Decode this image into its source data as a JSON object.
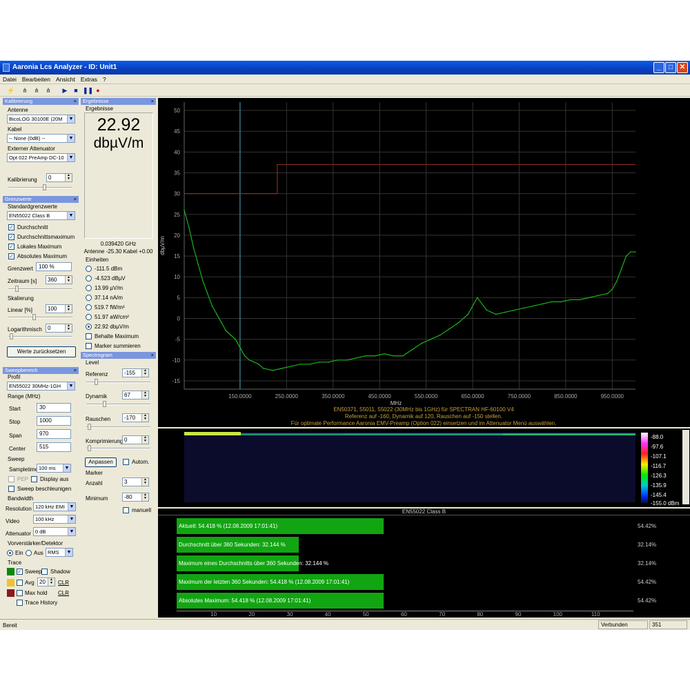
{
  "window": {
    "title": "Aaronia Lcs Analyzer - ID: Unit1"
  },
  "menu": [
    "Datei",
    "Bearbeiten",
    "Ansicht",
    "Extras",
    "?"
  ],
  "toolbar_icons": [
    "wand-icon",
    "antenna-icon",
    "antenna2-icon",
    "antenna3-icon",
    "play-icon",
    "stop-icon",
    "pause-icon",
    "record-icon"
  ],
  "kalibrierung": {
    "header": "Kalibrierung",
    "antenne_label": "Antenne",
    "antenne_value": "BicoLOG 30100E (20M",
    "kabel_label": "Kabel",
    "kabel_value": "-- None (0dB) --",
    "att_label": "Externer Attenuator",
    "att_value": "Opt 022 PreAmp DC-10",
    "kal_label": "Kalibrierung",
    "kal_value": "0"
  },
  "grenzwerte": {
    "header": "Grenzwerte",
    "std_label": "Standardgrenzwerte",
    "std_value": "EN55022 Class B",
    "checks": [
      "Durchschnitt",
      "Durchschnittsmaximum",
      "Lokales Maximum",
      "Absolutes Maximum"
    ],
    "grenzwert_label": "Grenzwert",
    "grenzwert_value": "100 %",
    "zeitraum_label": "Zeitraum [s]",
    "zeitraum_value": "360",
    "skal_label": "Skalierung",
    "linear_label": "Linear [%]",
    "linear_value": "100",
    "log_label": "Logarithmisch",
    "log_value": "0",
    "reset_button": "Werte zurücksetzen"
  },
  "sweep": {
    "header": "Sweepbereich",
    "profil_label": "Profil",
    "profil_value": "EN55022 30MHz-1GH",
    "range_label": "Range (MHz)",
    "start_label": "Start",
    "start_value": "30",
    "stop_label": "Stop",
    "stop_value": "1000",
    "span_label": "Span",
    "span_value": "970",
    "center_label": "Center",
    "center_value": "515",
    "sweep_label": "Sweep",
    "sampletime_label": "Sampletime",
    "sampletime_value": "100 ms",
    "pep_label": "PEP",
    "display_label": "Display aus",
    "beschl_label": "Sweep beschleunigen",
    "bandwidth_label": "Bandwidth",
    "resolution_label": "Resolution",
    "resolution_value": "120 kHz EMI",
    "video_label": "Video",
    "video_value": "100 kHz",
    "atten_label": "Attenuator",
    "atten_value": "0 dB",
    "vorv_label": "Vorverstärker/Detektor",
    "ein_label": "Ein",
    "aus_label": "Aus",
    "det_value": "RMS",
    "trace_label": "Trace",
    "sweep_cb": "Sweep",
    "shadow_cb": "Shadow",
    "avg_cb": "Avg",
    "avg_value": "20",
    "clr": "CLR",
    "maxhold_cb": "Max hold",
    "history_cb": "Trace History",
    "colors": [
      "#0a8a0a",
      "#f2c12e",
      "#8b1a1a"
    ]
  },
  "ergebnisse": {
    "header": "Ergebnisse",
    "group": "Ergebnisse",
    "value": "22.92",
    "unit": "dbµV/m",
    "freq": "0.039420 GHz",
    "antenne": "Antenne -25.30 Kabel +0.00",
    "einheiten_label": "Einheiten",
    "units": [
      "-111.5 dBm",
      "-4.523 dBµV",
      "13.99 µV/m",
      "37.14 nA/m",
      "519.7 fW/m²",
      "51.97 aW/cm²",
      "22.92 dbµV/m"
    ],
    "selected_unit_index": 6,
    "behalte": "Behalte Maximum",
    "summieren": "Marker summieren"
  },
  "spectrogram": {
    "header": "Spectrogram",
    "level_label": "Level",
    "referenz_label": "Referenz",
    "referenz_value": "-155",
    "dynamik_label": "Dynamik",
    "dynamik_value": "67",
    "rauschen_label": "Rauschen",
    "rauschen_value": "-170",
    "kompr_label": "Komprimierung",
    "kompr_value": "0",
    "anpassen_button": "Anpassen",
    "autom_label": "Autom.",
    "marker_label": "Marker",
    "anzahl_label": "Anzahl",
    "anzahl_value": "3",
    "minimum_label": "Minimum",
    "minimum_value": "-80",
    "manuell_label": "manuell",
    "scale": [
      "-88.0",
      "-97.6",
      "-107.1",
      "-116.7",
      "-126.3",
      "-135.9",
      "-145.4",
      "-155.0 dBm"
    ]
  },
  "chart_data": {
    "type": "line",
    "ylabel": "dbµV/m",
    "xlabel": "MHz",
    "xlim": [
      30,
      1000
    ],
    "ylim": [
      -17,
      52
    ],
    "y_ticks": [
      50,
      45,
      40,
      35,
      30,
      25,
      20,
      15,
      10,
      5,
      0,
      -5,
      -10,
      -15
    ],
    "x_ticks": [
      "150.0000",
      "250.0000",
      "350.0000",
      "450.0000",
      "550.0000",
      "650.0000",
      "750.0000",
      "850.0000",
      "950.0000"
    ],
    "limit_line": {
      "x": [
        30,
        230,
        230,
        1000
      ],
      "y": [
        30,
        30,
        37,
        37
      ],
      "color": "#8b2a1a"
    },
    "marker_x": 150,
    "series": [
      {
        "color": "#19b419",
        "x": [
          30,
          40,
          50,
          60,
          70,
          80,
          90,
          100,
          110,
          120,
          130,
          140,
          150,
          160,
          170,
          180,
          190,
          200,
          220,
          240,
          260,
          280,
          300,
          320,
          340,
          360,
          380,
          400,
          420,
          440,
          460,
          480,
          500,
          520,
          540,
          560,
          580,
          600,
          620,
          640,
          660,
          680,
          700,
          720,
          740,
          760,
          780,
          800,
          820,
          840,
          860,
          880,
          900,
          920,
          940,
          950,
          960,
          970,
          980,
          990,
          1000
        ],
        "y": [
          26,
          22,
          17,
          13,
          9,
          6,
          3,
          1,
          -1,
          -3,
          -4,
          -5,
          -7,
          -9,
          -10,
          -10.5,
          -11,
          -12,
          -12.5,
          -12,
          -11.5,
          -11,
          -11,
          -10.5,
          -10.5,
          -10,
          -10,
          -9.5,
          -9,
          -9,
          -8.5,
          -9,
          -9,
          -7.5,
          -6,
          -5,
          -4,
          -2.5,
          -1,
          1,
          5,
          2,
          1,
          1.5,
          2,
          2.5,
          3,
          3.5,
          4,
          4,
          4.5,
          4.5,
          5,
          5.5,
          6,
          7,
          9,
          12,
          15,
          16,
          16
        ]
      }
    ],
    "annotation": [
      "EN50371, 55011, 55022 (30MHz bis 1GHz) für SPECTRAN HF-60100 V4",
      "Referenz auf -160, Dynamik auf 120, Rauschen auf -150 stellen.",
      "Für optimale Performance Aaronia EMV-Preamp (Option 022) einsetzen und im Attenuator Menü auswählen."
    ]
  },
  "limits_panel": {
    "title": "EN55022 Class B",
    "bars": [
      {
        "label": "Aktuell: 54.418 % (12.08.2009 17:01:41)",
        "value": 54.418,
        "pct": "54.42%"
      },
      {
        "label": "Durchschnitt über 360 Sekunden: 32.144 %",
        "value": 32.144,
        "pct": "32.14%"
      },
      {
        "label": "Maximum eines Durchschnitts über 360 Sekunden: 32.144 %",
        "value": 32.144,
        "pct": "32.14%"
      },
      {
        "label": "Maximum der letzten 360 Sekunden: 54.418 % (12.08.2009 17:01:41)",
        "value": 54.418,
        "pct": "54.42%"
      },
      {
        "label": "Absolutes Maximum: 54.418 % (12.08.2009 17:01:41)",
        "value": 54.418,
        "pct": "54.42%"
      }
    ],
    "x_ticks": [
      "10",
      "20",
      "30",
      "40",
      "50",
      "60",
      "70",
      "80",
      "90",
      "100",
      "110"
    ],
    "xmax": 120
  },
  "status": {
    "left": "Bereit",
    "connection": "Verbunden",
    "count": "351"
  }
}
